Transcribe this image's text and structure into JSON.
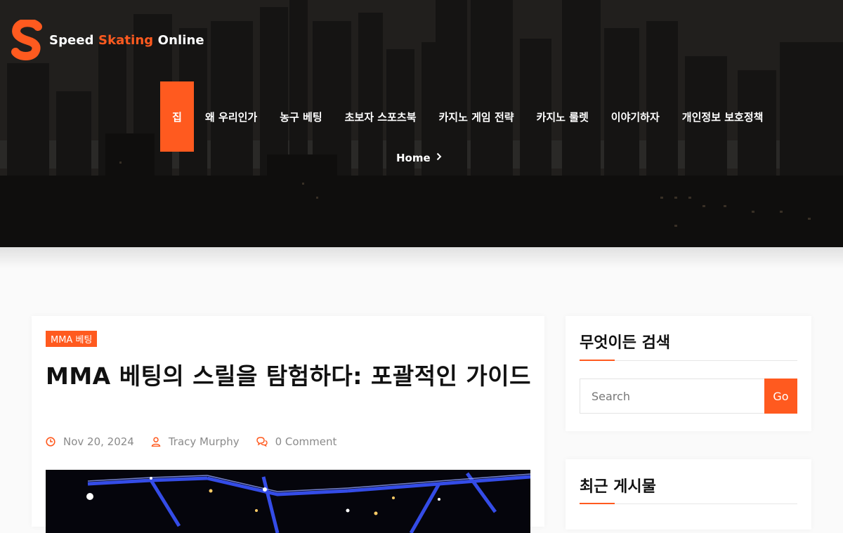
{
  "brand": {
    "name_part1": "Speed ",
    "name_accent": "Skating",
    "name_part2": " Online",
    "accent_color": "#ff5a1f"
  },
  "nav": {
    "items": [
      {
        "label": "집",
        "active": true
      },
      {
        "label": "왜 우리인가"
      },
      {
        "label": "농구 베팅"
      },
      {
        "label": "초보자 스포츠북"
      },
      {
        "label": "카지노 게임 전략"
      },
      {
        "label": "카지노 룰렛"
      },
      {
        "label": "이야기하자"
      },
      {
        "label": "개인정보 보호정책"
      }
    ]
  },
  "breadcrumb": {
    "home": "Home"
  },
  "article": {
    "category": "MMA 베팅",
    "title": "MMA 베팅의 스릴을 탐험하다: 포괄적인 가이드",
    "date": "Nov 20, 2024",
    "author": "Tracy Murphy",
    "comments": "0 Comment"
  },
  "sidebar": {
    "search_widget": {
      "title": "무엇이든 검색",
      "placeholder": "Search",
      "button": "Go"
    },
    "recent_widget": {
      "title": "최근 게시물"
    }
  },
  "icons": {
    "date": "clock-icon",
    "author": "user-icon",
    "comments": "comments-icon",
    "breadcrumb": "chevron-right-icon"
  }
}
